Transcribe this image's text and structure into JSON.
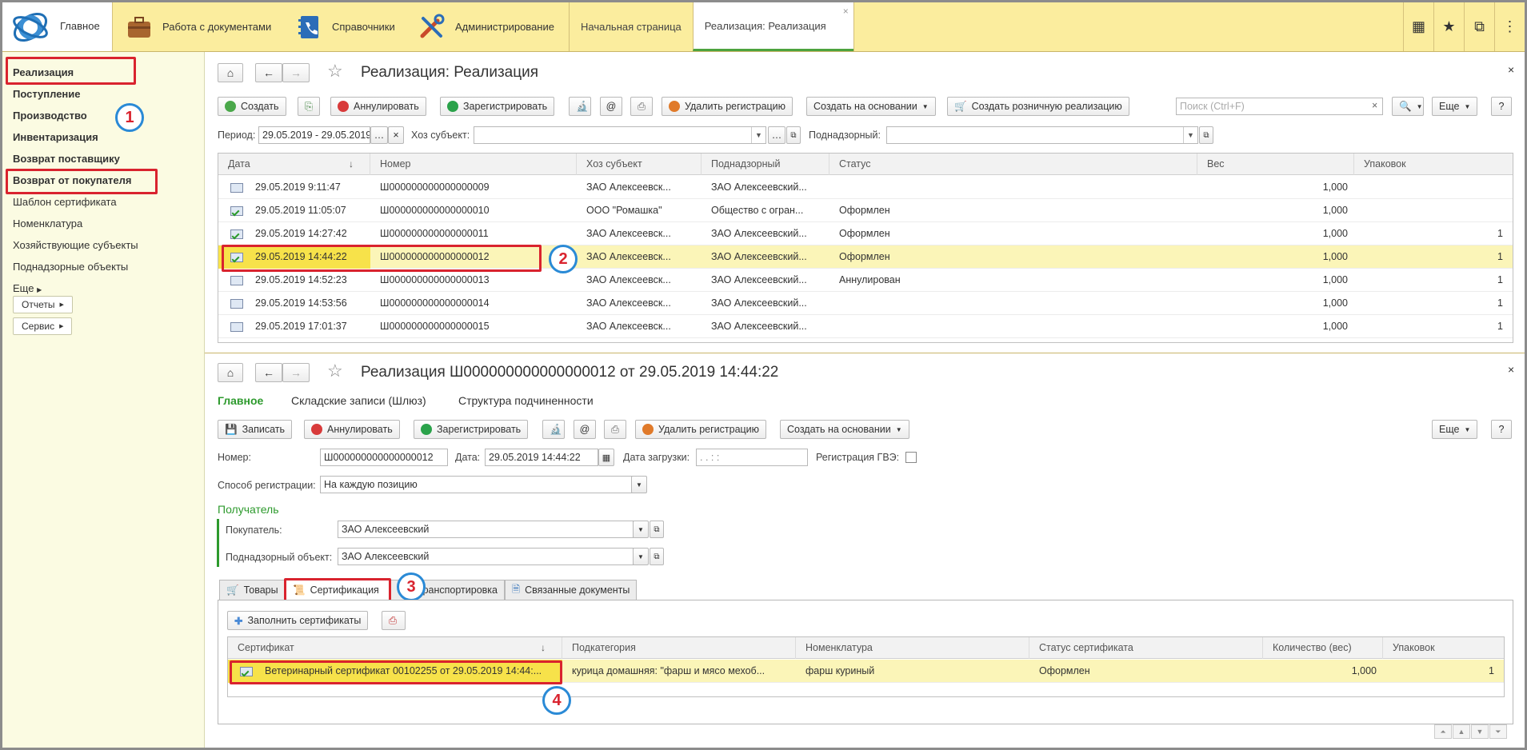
{
  "topbar": {
    "main_label": "Главное",
    "sections": [
      {
        "label": "Работа с документами",
        "icon": "briefcase-icon"
      },
      {
        "label": "Справочники",
        "icon": "phonebook-icon"
      },
      {
        "label": "Администрирование",
        "icon": "tools-icon"
      }
    ],
    "open_tabs": [
      {
        "label": "Начальная страница"
      },
      {
        "label": "Реализация: Реализация",
        "close": "×"
      }
    ],
    "right_icons": [
      "grid-icon",
      "star-icon",
      "copy-icon",
      "menu-icon"
    ]
  },
  "leftnav": {
    "items": [
      {
        "label": "Реализация",
        "bold": true
      },
      {
        "label": "Поступление",
        "bold": true
      },
      {
        "label": "Производство",
        "bold": true
      },
      {
        "label": "Инвентаризация",
        "bold": true
      },
      {
        "label": "Возврат поставщику",
        "bold": true
      },
      {
        "label": "Возврат от покупателя",
        "bold": true
      },
      {
        "label": "Шаблон сертификата",
        "bold": false
      },
      {
        "label": "Номенклатура",
        "bold": false
      },
      {
        "label": "Хозяйствующие субъекты",
        "bold": false
      },
      {
        "label": "Поднадзорные объекты",
        "bold": false
      },
      {
        "label": "Еще",
        "bold": false
      }
    ],
    "buttons": [
      "Отчеты",
      "Сервис"
    ]
  },
  "badges": [
    "1",
    "2",
    "3",
    "4"
  ],
  "list_panel": {
    "title": "Реализация: Реализация",
    "toolbar": {
      "create": "Создать",
      "annul": "Аннулировать",
      "register": "Зарегистрировать",
      "at": "@",
      "delete_reg": "Удалить регистрацию",
      "create_based": "Создать на основании",
      "create_retail": "Создать розничную реализацию",
      "search_placeholder": "Поиск (Ctrl+F)",
      "more": "Еще",
      "help": "?"
    },
    "filters": {
      "period_label": "Период:",
      "period_value": "29.05.2019 - 29.05.2019",
      "subject_label": "Хоз субъект:",
      "supervised_label": "Поднадзорный:"
    },
    "columns": [
      "Дата",
      "Номер",
      "Хоз субъект",
      "Поднадзорный",
      "Статус",
      "Вес",
      "Упаковок"
    ],
    "rows": [
      {
        "date": "29.05.2019 9:11:47",
        "number": "Ш000000000000000009",
        "subject": "ЗАО  Алексеевск...",
        "supervised": "ЗАО Алексеевский...",
        "status": "",
        "weight": "1,000",
        "packs": "",
        "ok": false
      },
      {
        "date": "29.05.2019 11:05:07",
        "number": "Ш000000000000000010",
        "subject": "ООО \"Ромашка\"",
        "supervised": "Общество с огран...",
        "status": "Оформлен",
        "weight": "1,000",
        "packs": "",
        "ok": true
      },
      {
        "date": "29.05.2019 14:27:42",
        "number": "Ш000000000000000011",
        "subject": "ЗАО  Алексеевск...",
        "supervised": "ЗАО Алексеевский...",
        "status": "Оформлен",
        "weight": "1,000",
        "packs": "1",
        "ok": true
      },
      {
        "date": "29.05.2019 14:44:22",
        "number": "Ш000000000000000012",
        "subject": "ЗАО  Алексеевск...",
        "supervised": "ЗАО Алексеевский...",
        "status": "Оформлен",
        "weight": "1,000",
        "packs": "1",
        "ok": true,
        "selected": true
      },
      {
        "date": "29.05.2019 14:52:23",
        "number": "Ш000000000000000013",
        "subject": "ЗАО  Алексеевск...",
        "supervised": "ЗАО Алексеевский...",
        "status": "Аннулирован",
        "weight": "1,000",
        "packs": "1",
        "ok": false
      },
      {
        "date": "29.05.2019 14:53:56",
        "number": "Ш000000000000000014",
        "subject": "ЗАО  Алексеевск...",
        "supervised": "ЗАО Алексеевский...",
        "status": "",
        "weight": "1,000",
        "packs": "1",
        "ok": false
      },
      {
        "date": "29.05.2019 17:01:37",
        "number": "Ш000000000000000015",
        "subject": "ЗАО  Алексеевск...",
        "supervised": "ЗАО Алексеевский...",
        "status": "",
        "weight": "1,000",
        "packs": "1",
        "ok": false
      }
    ]
  },
  "doc_panel": {
    "title": "Реализация Ш000000000000000012 от 29.05.2019 14:44:22",
    "sections": [
      "Главное",
      "Складские записи (Шлюз)",
      "Структура подчиненности"
    ],
    "toolbar": {
      "save": "Записать",
      "annul": "Аннулировать",
      "register": "Зарегистрировать",
      "at": "@",
      "delete_reg": "Удалить регистрацию",
      "create_based": "Создать на основании",
      "more": "Еще",
      "help": "?"
    },
    "fields": {
      "number_label": "Номер:",
      "number_value": "Ш000000000000000012",
      "date_label": "Дата:",
      "date_value": "29.05.2019 14:44:22",
      "load_date_label": "Дата загрузки:",
      "load_date_value": " .  .       :  :",
      "gve_label": "Регистрация ГВЭ:",
      "method_label": "Способ регистрации:",
      "method_value": "На каждую позицию",
      "recipient_group": "Получатель",
      "buyer_label": "Покупатель:",
      "buyer_value": "ЗАО  Алексеевский",
      "object_label": "Поднадзорный объект:",
      "object_value": "ЗАО Алексеевский"
    },
    "tabs": [
      "Товары",
      "Сертификация",
      "Транспортировка",
      "Связанные документы"
    ],
    "fill_button": "Заполнить сертификаты",
    "columns": [
      "Сертификат",
      "Подкатегория",
      "Номенклатура",
      "Статус сертификата",
      "Количество (вес)",
      "Упаковок"
    ],
    "rows": [
      {
        "cert": "Ветеринарный сертификат 00102255 от 29.05.2019 14:44:...",
        "subcat": "курица домашняя: \"фарш и мясо мехоб...",
        "nomen": "фарш куриный",
        "status": "Оформлен",
        "qty": "1,000",
        "packs": "1"
      }
    ]
  }
}
